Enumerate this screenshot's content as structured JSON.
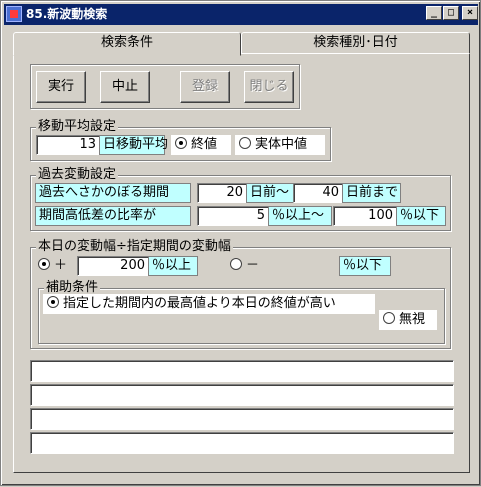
{
  "window": {
    "title": "85.新波動検索"
  },
  "titlebar_buttons": {
    "minimize": "_",
    "maximize": "□",
    "close": "×"
  },
  "tabs": [
    {
      "label": "検索条件",
      "active": true
    },
    {
      "label": "検索種別･日付",
      "active": false
    }
  ],
  "toolbar": {
    "run_label": "実行",
    "stop_label": "中止",
    "register_label": "登録",
    "close_label": "閉じる"
  },
  "moving_average": {
    "title": "移動平均設定",
    "days_value": "13",
    "days_label": "日移動平均",
    "option_close": "終値",
    "option_body": "実体中値",
    "selected": "終値"
  },
  "past_fluctuation": {
    "title": "過去変動設定",
    "lookback_label": "過去へさかのぼる期間",
    "from_value": "20",
    "from_unit": "日前～",
    "to_value": "40",
    "to_unit": "日前まで",
    "ratio_label": "期間高低差の比率が",
    "ratio_min_value": "5",
    "ratio_min_unit": "％以上～",
    "ratio_max_value": "100",
    "ratio_max_unit": "％以下"
  },
  "today_ratio": {
    "title": "本日の変動幅÷指定期間の変動幅",
    "plus_label": "＋",
    "plus_value": "200",
    "plus_unit": "％以上",
    "minus_label": "－",
    "minus_unit": "％以下",
    "selected": "plus"
  },
  "auxiliary": {
    "title": "補助条件",
    "option_high": "指定した期間内の最高値より本日の終値が高い",
    "option_ignore": "無視",
    "selected": "high"
  },
  "results": [
    "",
    "",
    "",
    ""
  ],
  "colors": {
    "titlebar": "#0a246a",
    "label_bg": "#c0ffff",
    "face": "#d4d0c8"
  }
}
